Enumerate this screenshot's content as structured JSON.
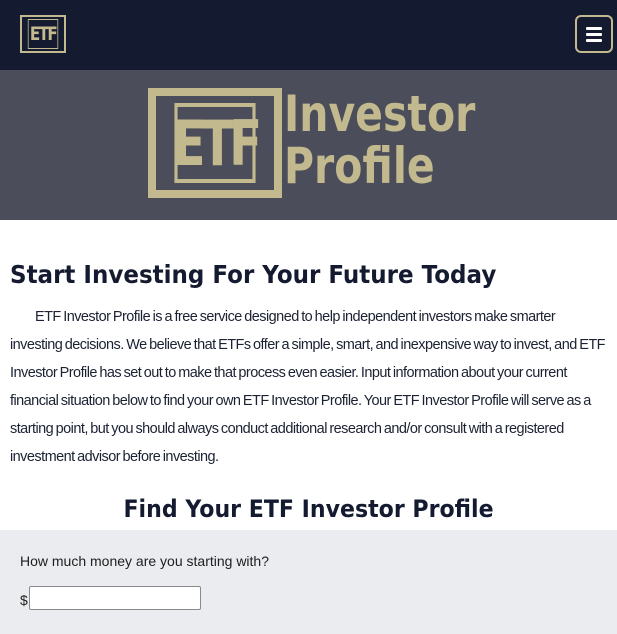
{
  "navbar": {
    "logo_text": "ETF",
    "menu_icon": "hamburger-icon"
  },
  "banner": {
    "logo_text": "ETF",
    "line1": "Investor",
    "line2": "Profile"
  },
  "main": {
    "headline": "Start Investing For Your Future Today",
    "intro": "ETF Investor Profile is a free service designed to help independent investors make smarter investing decisions. We believe that ETFs offer a simple, smart, and inexpensive way to invest, and ETF Investor Profile has set out to make that process even easier. Input information about your current financial situation below to find your own ETF Investor Profile. Your ETF Investor Profile will serve as a starting point, but you should always conduct additional research and/or consult with a registered investment advisor before investing.",
    "section_title": "Find Your ETF Investor Profile"
  },
  "form": {
    "question": "How much money are you starting with?",
    "currency_symbol": "$",
    "amount_value": ""
  },
  "colors": {
    "navbar_bg": "#141a30",
    "banner_bg": "#4b4e5a",
    "accent_gold": "#c3b98f",
    "form_bg": "#ebecf0"
  }
}
